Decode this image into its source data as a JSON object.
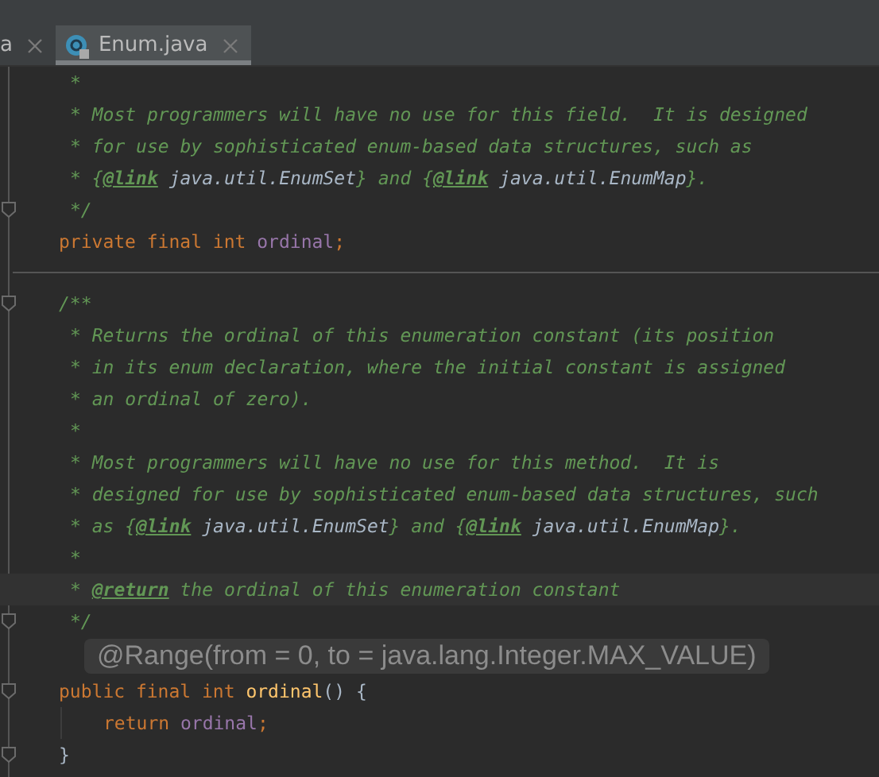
{
  "tabs": [
    {
      "label": "a",
      "selected": false,
      "icon": false
    },
    {
      "label": "Enum.java",
      "selected": true,
      "icon": true
    }
  ],
  "lines": [
    {
      "kind": "doc",
      "current": false,
      "fold": false,
      "tokens": [
        {
          "kind": "comment",
          "text": "*"
        }
      ]
    },
    {
      "kind": "doc",
      "current": false,
      "fold": false,
      "tokens": [
        {
          "kind": "comment",
          "text": "* Most programmers will have no use for this field.  It is designed"
        }
      ]
    },
    {
      "kind": "doc",
      "current": false,
      "fold": false,
      "tokens": [
        {
          "kind": "comment",
          "text": "* for use by sophisticated enum-based data structures, such as"
        }
      ]
    },
    {
      "kind": "doc",
      "current": false,
      "fold": false,
      "tokens": [
        {
          "kind": "comment",
          "text": "* {"
        },
        {
          "kind": "tag",
          "text": "@link"
        },
        {
          "kind": "ref",
          "text": " java.util.EnumSet"
        },
        {
          "kind": "comment",
          "text": "} and {"
        },
        {
          "kind": "tag",
          "text": "@link"
        },
        {
          "kind": "ref",
          "text": " java.util.EnumMap"
        },
        {
          "kind": "comment",
          "text": "}."
        }
      ]
    },
    {
      "kind": "doc",
      "current": false,
      "fold": true,
      "tokens": [
        {
          "kind": "comment",
          "text": "*/"
        }
      ]
    },
    {
      "kind": "code",
      "current": false,
      "fold": false,
      "tokens": [
        {
          "kind": "keyword",
          "text": "private final int "
        },
        {
          "kind": "field",
          "text": "ordinal"
        },
        {
          "kind": "keyword",
          "text": ";"
        }
      ]
    },
    {
      "kind": "blank",
      "fold": false
    },
    {
      "kind": "separator",
      "fold": false
    },
    {
      "kind": "code",
      "current": false,
      "fold": true,
      "tokens": [
        {
          "kind": "comment",
          "text": "/**"
        }
      ]
    },
    {
      "kind": "doc",
      "current": false,
      "fold": false,
      "tokens": [
        {
          "kind": "comment",
          "text": "* Returns the ordinal of this enumeration constant (its position"
        }
      ]
    },
    {
      "kind": "doc",
      "current": false,
      "fold": false,
      "tokens": [
        {
          "kind": "comment",
          "text": "* in its enum declaration, where the initial constant is assigned"
        }
      ]
    },
    {
      "kind": "doc",
      "current": false,
      "fold": false,
      "tokens": [
        {
          "kind": "comment",
          "text": "* an ordinal of zero)."
        }
      ]
    },
    {
      "kind": "doc",
      "current": false,
      "fold": false,
      "tokens": [
        {
          "kind": "comment",
          "text": "*"
        }
      ]
    },
    {
      "kind": "doc",
      "current": false,
      "fold": false,
      "tokens": [
        {
          "kind": "comment",
          "text": "* Most programmers will have no use for this method.  It is"
        }
      ]
    },
    {
      "kind": "doc",
      "current": false,
      "fold": false,
      "tokens": [
        {
          "kind": "comment",
          "text": "* designed for use by sophisticated enum-based data structures, such"
        }
      ]
    },
    {
      "kind": "doc",
      "current": false,
      "fold": false,
      "tokens": [
        {
          "kind": "comment",
          "text": "* as {"
        },
        {
          "kind": "tag",
          "text": "@link"
        },
        {
          "kind": "ref",
          "text": " java.util.EnumSet"
        },
        {
          "kind": "comment",
          "text": "} and {"
        },
        {
          "kind": "tag",
          "text": "@link"
        },
        {
          "kind": "ref",
          "text": " java.util.EnumMap"
        },
        {
          "kind": "comment",
          "text": "}."
        }
      ]
    },
    {
      "kind": "doc",
      "current": false,
      "fold": false,
      "tokens": [
        {
          "kind": "comment",
          "text": "*"
        }
      ]
    },
    {
      "kind": "doc",
      "current": true,
      "fold": false,
      "tokens": [
        {
          "kind": "comment",
          "text": "* "
        },
        {
          "kind": "tag",
          "text": "@return"
        },
        {
          "kind": "comment",
          "text": " the ordinal of this enumeration constant"
        }
      ]
    },
    {
      "kind": "doc",
      "current": false,
      "fold": true,
      "tokens": [
        {
          "kind": "comment",
          "text": "*/"
        }
      ]
    },
    {
      "kind": "inlay",
      "current": false,
      "fold": false,
      "hint": "@Range(from = 0, to = java.lang.Integer.MAX_VALUE)"
    },
    {
      "kind": "code",
      "current": false,
      "fold": true,
      "tokens": [
        {
          "kind": "keyword",
          "text": "public final int "
        },
        {
          "kind": "method",
          "text": "ordinal"
        },
        {
          "kind": "plain",
          "text": "() {"
        }
      ]
    },
    {
      "kind": "body",
      "current": false,
      "fold": false,
      "tokens": [
        {
          "kind": "keyword",
          "text": "return "
        },
        {
          "kind": "field",
          "text": "ordinal"
        },
        {
          "kind": "keyword",
          "text": ";"
        }
      ]
    },
    {
      "kind": "code",
      "current": false,
      "fold": true,
      "tokens": [
        {
          "kind": "plain",
          "text": "}"
        }
      ]
    }
  ]
}
